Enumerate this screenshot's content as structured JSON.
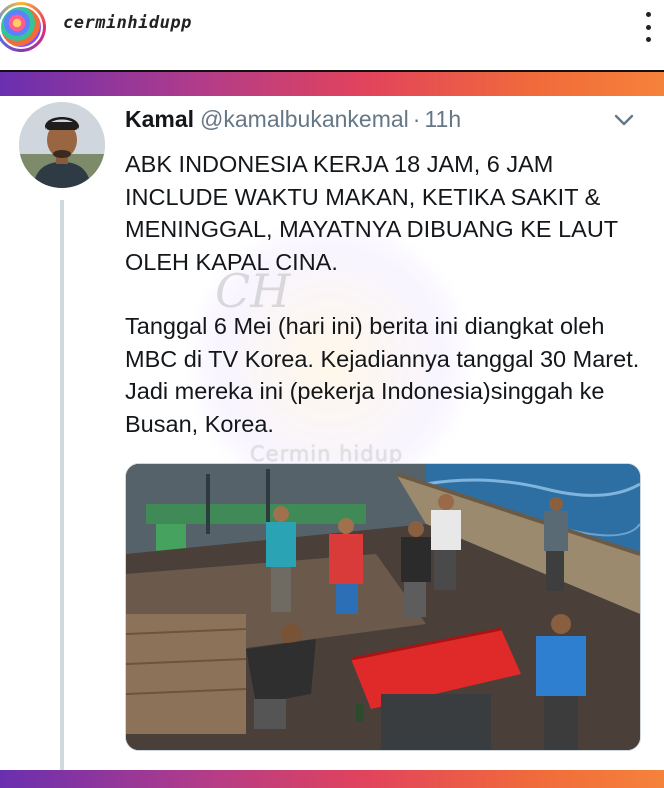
{
  "instagram": {
    "username": "cerminhidupp"
  },
  "tweet": {
    "author_name": "Kamal",
    "author_handle": "@kamalbukankemal",
    "separator": "·",
    "time": "11h",
    "paragraphs": [
      "ABK INDONESIA KERJA 18 JAM, 6 JAM INCLUDE WAKTU MAKAN, KETIKA SAKIT & MENINGGAL, MAYATNYA DIBUANG KE LAUT OLEH KAPAL CINA.",
      "Tanggal 6 Mei (hari ini) berita ini diangkat oleh MBC di TV Korea. Kejadiannya tanggal 30 Maret. Jadi mereka ini (pekerja Indonesia)singgah ke Busan, Korea."
    ]
  },
  "watermark": {
    "logo_text": "CH",
    "text": "Cermin hidup"
  },
  "icons": {
    "more": "more-vertical-icon",
    "caret": "chevron-down-icon"
  },
  "colors": {
    "gradient_start": "#6a2fb0",
    "gradient_end": "#f5823a",
    "handle_gray": "#657786",
    "thread_line": "#cfd9de"
  }
}
